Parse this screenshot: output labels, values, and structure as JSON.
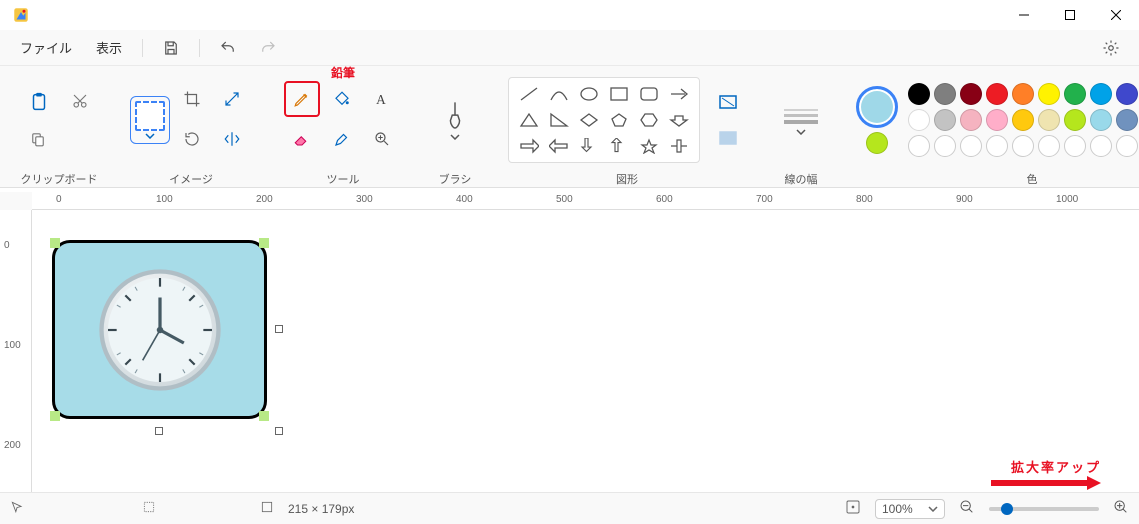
{
  "window": {
    "title": ""
  },
  "menu": {
    "file": "ファイル",
    "view": "表示"
  },
  "ribbon": {
    "clipboard": {
      "label": "クリップボード"
    },
    "image": {
      "label": "イメージ"
    },
    "tools": {
      "label": "ツール",
      "pencil_callout": "鉛筆"
    },
    "brushes": {
      "label": "ブラシ"
    },
    "shapes": {
      "label": "図形"
    },
    "stroke": {
      "label": "線の幅"
    },
    "colors": {
      "label": "色",
      "row1": [
        "#000000",
        "#7f7f7f",
        "#880015",
        "#ed1c24",
        "#ff7f27",
        "#fff200",
        "#22b14c",
        "#00a2e8",
        "#3f48cc",
        "#a349a4"
      ],
      "row2": [
        "#ffffff",
        "#c3c3c3",
        "#f5b3c0",
        "#ffaec9",
        "#ffc90e",
        "#efe4b0",
        "#b5e61d",
        "#99d9ea",
        "#7092be",
        "#c8bfe7"
      ],
      "active": "#9fd8e8",
      "secondary": "#b5e61d"
    }
  },
  "ruler": {
    "h": [
      "0",
      "100",
      "200",
      "300",
      "400",
      "500",
      "600",
      "700",
      "800",
      "900",
      "1000"
    ],
    "v": [
      "0",
      "100",
      "200"
    ]
  },
  "status": {
    "cursor": "",
    "size": "215 × 179px",
    "zoom": "100%"
  },
  "annotations": {
    "zoom_up": "拡大率アップ"
  }
}
